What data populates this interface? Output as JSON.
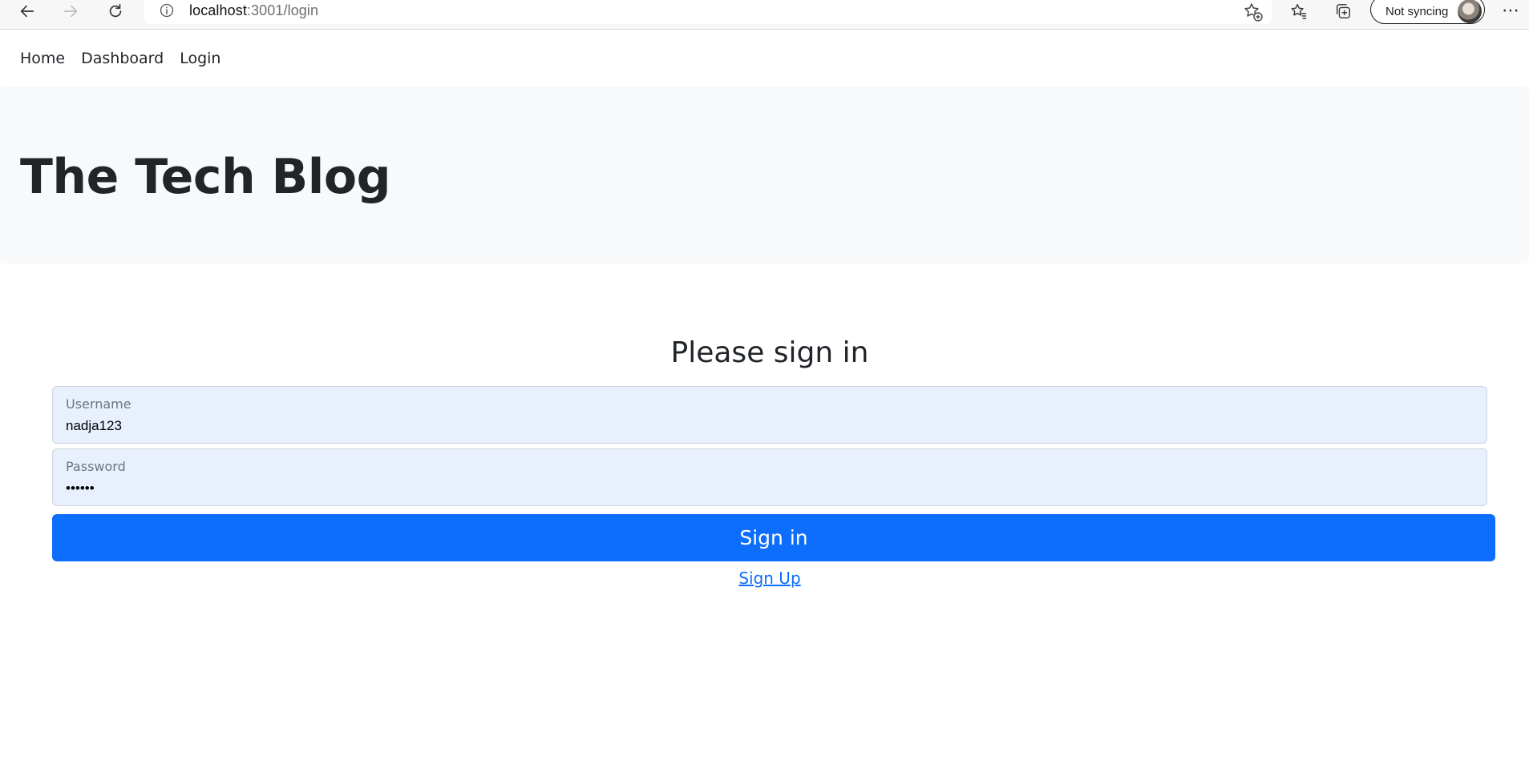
{
  "browser": {
    "url_host": "localhost",
    "url_path": ":3001/login",
    "sync_label": "Not syncing"
  },
  "navbar": {
    "items": [
      {
        "label": "Home"
      },
      {
        "label": "Dashboard"
      },
      {
        "label": "Login"
      }
    ]
  },
  "header": {
    "title": "The Tech Blog"
  },
  "form": {
    "title": "Please sign in",
    "username_label": "Username",
    "username_value": "nadja123",
    "password_label": "Password",
    "password_value": "••••••",
    "submit_label": "Sign in",
    "signup_label": "Sign Up"
  },
  "colors": {
    "primary": "#0d6efd",
    "header_bg": "#f8f9fa",
    "autofill_bg": "#e8f0fe"
  }
}
